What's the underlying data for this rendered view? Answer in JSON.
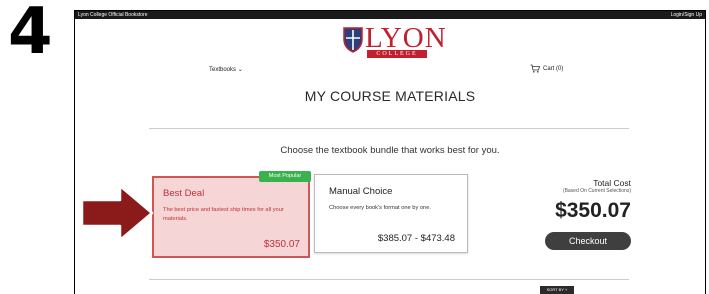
{
  "step_number": "4",
  "topbar": {
    "store_name": "Lyon College Official Bookstore",
    "login_label": "Login/Sign Up"
  },
  "logo": {
    "wordmark": "LYON",
    "subtext": "COLLEGE"
  },
  "nav": {
    "textbooks_label": "Textbooks",
    "cart_label": "Cart (0)"
  },
  "page_title": "MY COURSE MATERIALS",
  "subtitle": "Choose the textbook bundle that works best for you.",
  "bundles": {
    "best": {
      "badge": "Most Popular",
      "title": "Best Deal",
      "description": "The best price and fastest ship times for all your materials.",
      "price": "$350.07"
    },
    "manual": {
      "title": "Manual Choice",
      "description": "Choose every book's format one by one.",
      "price": "$385.07 - $473.48"
    }
  },
  "total": {
    "title": "Total Cost",
    "subtitle": "(Based On Current Selections)",
    "amount": "$350.07",
    "checkout_label": "Checkout"
  },
  "sort_label": "SORT BY",
  "colors": {
    "brand_red": "#c3202f",
    "annotation_arrow": "#8b1a1a",
    "badge_green": "#37b24d"
  }
}
